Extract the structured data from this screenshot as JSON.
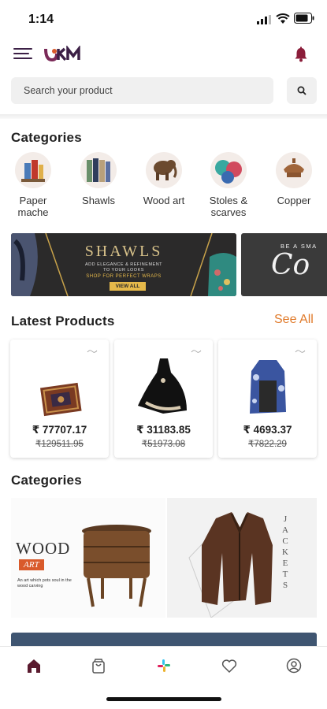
{
  "status_bar": {
    "time": "1:14",
    "icons": [
      "signal-icon",
      "wifi-icon",
      "battery-icon"
    ]
  },
  "header": {
    "logo": "UKM",
    "menu_icon": "hamburger-icon",
    "bell_icon": "bell-icon"
  },
  "search": {
    "placeholder": "Search your product",
    "icon": "search-icon"
  },
  "categories_title": "Categories",
  "categories": [
    {
      "label": "Paper\nmache"
    },
    {
      "label": "Shawls"
    },
    {
      "label": "Wood art"
    },
    {
      "label": "Stoles &\nscarves"
    },
    {
      "label": "Copper"
    }
  ],
  "banners": [
    {
      "title": "SHAWLS",
      "line1": "ADD ELEGANCE & REFINEMENT",
      "line2": "TO YOUR LOOKS",
      "line3": "SHOP FOR PERFECT WRAPS",
      "cta": "VIEW ALL"
    },
    {
      "line1": "BE A SMA",
      "script": "Co"
    }
  ],
  "latest": {
    "title": "Latest Products",
    "see_all": "See All"
  },
  "products": [
    {
      "price": "₹ 77707.17",
      "mrp": "₹129511.95"
    },
    {
      "price": "₹ 31183.85",
      "mrp": "₹51973.08"
    },
    {
      "price": "₹ 4693.37",
      "mrp": "₹7822.29"
    }
  ],
  "categories2_title": "Categories",
  "tiles": [
    {
      "word": "WOOD",
      "sub": "ART",
      "caption": "An art which pots soul in the wood carving"
    },
    {
      "vertical": "JACKETS"
    }
  ],
  "bottom_nav": [
    "home-icon",
    "bag-icon",
    "slack-icon",
    "heart-icon",
    "profile-icon"
  ],
  "colors": {
    "brand": "#3c2046",
    "bell": "#8b1d3a",
    "accent": "#e07a2a",
    "home_active": "#5a1a2e"
  }
}
